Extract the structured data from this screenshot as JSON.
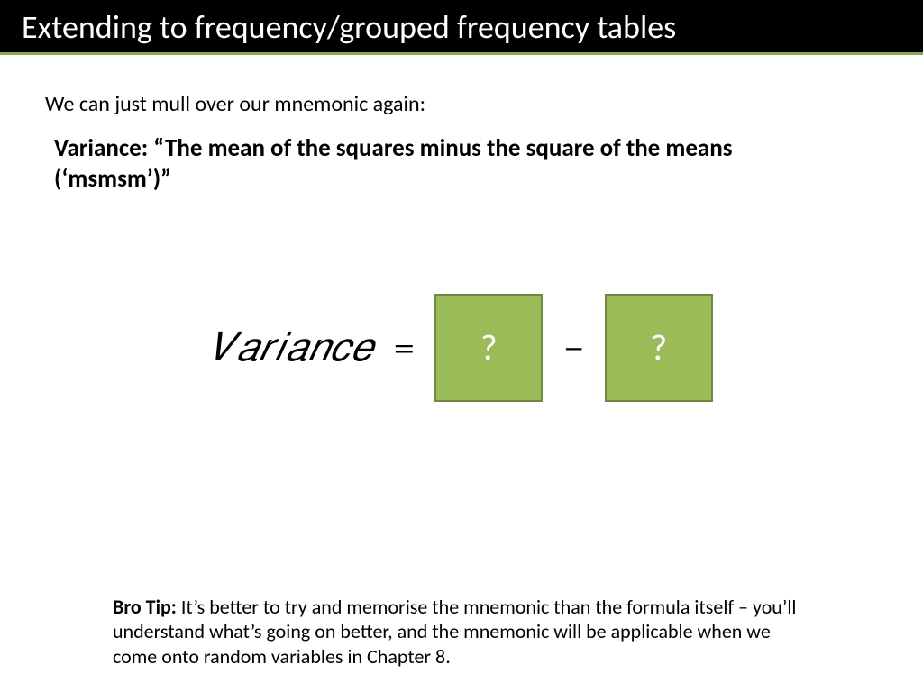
{
  "header": {
    "title": "Extending to frequency/grouped frequency tables"
  },
  "intro": "We can just mull over our mnemonic again:",
  "mnemonic": "Variance: “The mean of the squares minus the square of the means (‘msmsm’)”",
  "formula": {
    "label": "𝑉𝑎𝑟𝑖𝑎𝑛𝑐𝑒",
    "equals": "=",
    "box1": "?",
    "minus": "−",
    "box2": "?"
  },
  "tip": {
    "lead": "Bro Tip:",
    "body": " It’s better to try and memorise the mnemonic than the formula itself – you’ll understand what’s going on better, and the mnemonic will be applicable when we come onto random variables in Chapter 8."
  }
}
